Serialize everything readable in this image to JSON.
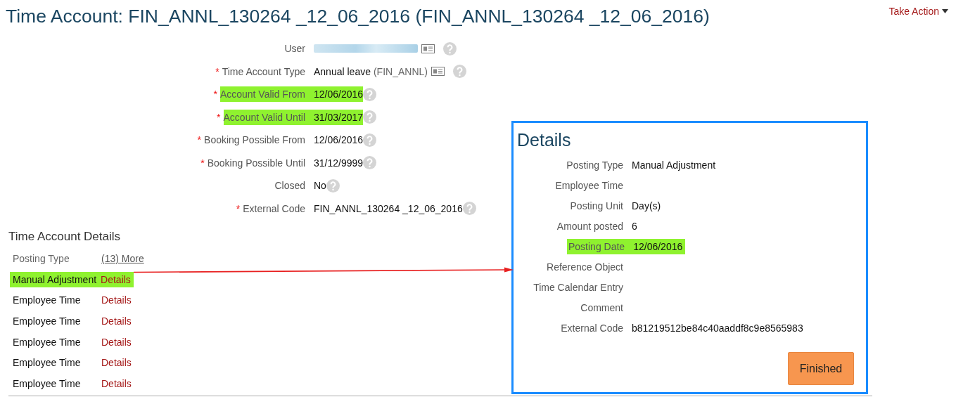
{
  "title": "Time Account: FIN_ANNL_130264 _12_06_2016 (FIN_ANNL_130264 _12_06_2016)",
  "take_action": {
    "label": "Take Action"
  },
  "fields": [
    {
      "kind": "blurred",
      "label": "User",
      "highlighted": false,
      "card_icon": true
    },
    {
      "kind": "text",
      "required_mark": "*",
      "label": "Time Account Type",
      "highlighted": false,
      "value": "Annual leave",
      "code": "(FIN_ANNL)",
      "card_icon": true
    },
    {
      "kind": "text",
      "required_mark": "*",
      "label": "Account Valid From",
      "highlighted": true,
      "value": "12/06/2016",
      "card_icon": false
    },
    {
      "kind": "text",
      "required_mark": "*",
      "label": "Account Valid Until",
      "highlighted": true,
      "value": "31/03/2017",
      "card_icon": false
    },
    {
      "kind": "text",
      "required_mark": "*",
      "label": "Booking Possible From",
      "highlighted": false,
      "value": "12/06/2016",
      "card_icon": false
    },
    {
      "kind": "text",
      "required_mark": "*",
      "label": "Booking Possible Until",
      "highlighted": false,
      "value": "31/12/9999",
      "card_icon": false
    },
    {
      "kind": "text",
      "label": "Closed",
      "highlighted": false,
      "value": "No",
      "card_icon": false
    },
    {
      "kind": "text",
      "required_mark": "*",
      "label": "External Code",
      "highlighted": false,
      "value": "FIN_ANNL_130264 _12_06_2016",
      "card_icon": false
    }
  ],
  "details_section": {
    "title": "Time Account Details",
    "header": "Posting Type",
    "more_link": "(13) More",
    "rows": [
      {
        "type": "Manual Adjustment",
        "link": "Details",
        "highlighted": true
      },
      {
        "type": "Employee Time",
        "link": "Details",
        "highlighted": false
      },
      {
        "type": "Employee Time",
        "link": "Details",
        "highlighted": false
      },
      {
        "type": "Employee Time",
        "link": "Details",
        "highlighted": false
      },
      {
        "type": "Employee Time",
        "link": "Details",
        "highlighted": false
      },
      {
        "type": "Employee Time",
        "link": "Details",
        "highlighted": false
      }
    ]
  },
  "details_panel": {
    "title": "Details",
    "fields": [
      {
        "label": "Posting Type",
        "value": "Manual Adjustment",
        "highlighted": false
      },
      {
        "label": "Employee Time",
        "highlighted": false
      },
      {
        "label": "Posting Unit",
        "value": "Day(s)",
        "highlighted": false
      },
      {
        "label": "Amount posted",
        "value": "6",
        "highlighted": false
      },
      {
        "label": "Posting Date",
        "value": "12/06/2016",
        "highlighted": true
      },
      {
        "label": "Reference Object",
        "highlighted": false
      },
      {
        "label": "Time Calendar Entry",
        "highlighted": false
      },
      {
        "label": "Comment",
        "highlighted": false
      },
      {
        "label": "External Code",
        "value": "b81219512be84c40aaddf8c9e8565983",
        "highlighted": false
      }
    ],
    "button": "Finished"
  }
}
